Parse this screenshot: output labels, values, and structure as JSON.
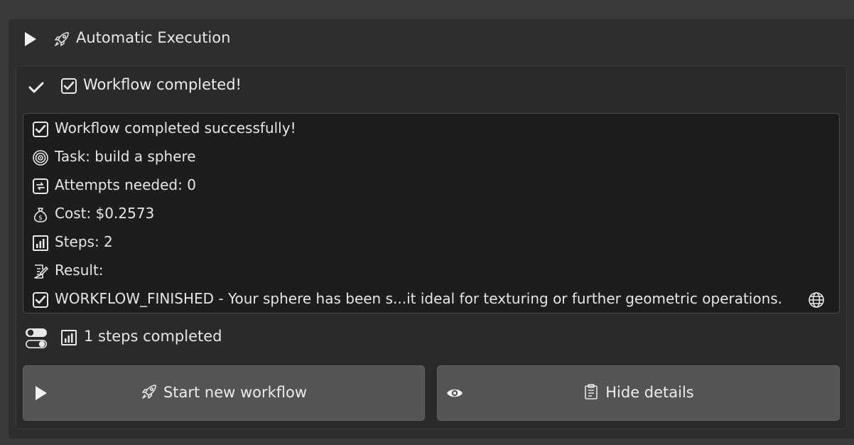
{
  "panel": {
    "title": "Automatic Execution",
    "icons": {
      "expand": "play-icon",
      "title": "rocket-icon"
    }
  },
  "status": {
    "title": "Workflow completed!",
    "icons": {
      "state": "checkmark-icon",
      "title": "checkbox-icon"
    }
  },
  "log": {
    "lines": [
      {
        "icon": "checkbox-icon",
        "text": "Workflow completed successfully!"
      },
      {
        "icon": "target-icon",
        "text": "Task: build a sphere"
      },
      {
        "icon": "repeat-icon",
        "text": "Attempts needed: 0"
      },
      {
        "icon": "money-bag-icon",
        "text": "Cost: $0.2573"
      },
      {
        "icon": "bar-chart-icon",
        "text": "Steps: 2"
      },
      {
        "icon": "memo-icon",
        "text": "Result:"
      },
      {
        "icon": "checkbox-icon",
        "text": "WORKFLOW_FINISHED  -  Your sphere has been s...it ideal for texturing or further geometric operations.",
        "trailing_icon": "globe-icon"
      }
    ]
  },
  "steps": {
    "text": "1 steps completed",
    "icons": {
      "toggle": "toggle-icon",
      "chart": "bar-chart-icon"
    }
  },
  "buttons": {
    "start": {
      "label": "Start new workflow",
      "icon": "rocket-icon",
      "lead_icon": "play-icon"
    },
    "hide": {
      "label": "Hide details",
      "icon": "clipboard-icon",
      "lead_icon": "eye-icon"
    }
  },
  "colors": {
    "background": "#3a3a3a",
    "panel": "#2e2e2e",
    "log_background": "#1d1d1d",
    "button": "#545454",
    "text": "#e6e6e6"
  }
}
